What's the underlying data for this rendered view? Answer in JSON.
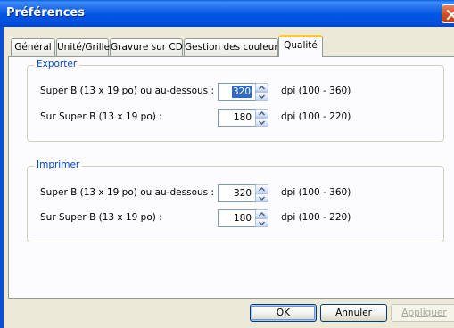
{
  "window": {
    "title": "Préférences"
  },
  "tabs": [
    {
      "label": "Général",
      "active": false
    },
    {
      "label": "Unité/Grille",
      "active": false
    },
    {
      "label": "Gravure sur CD",
      "active": false
    },
    {
      "label": "Gestion des couleurs",
      "active": false
    },
    {
      "label": "Qualité",
      "active": true
    }
  ],
  "export_group": {
    "title": "Exporter",
    "rows": [
      {
        "label": "Super B (13 x 19 po) ou au-dessous :",
        "value": "320",
        "range": "dpi (100 - 360)",
        "selected": true
      },
      {
        "label": "Sur Super B (13 x 19 po) :",
        "value": "180",
        "range": "dpi (100 - 220)",
        "selected": false
      }
    ]
  },
  "print_group": {
    "title": "Imprimer",
    "rows": [
      {
        "label": "Super B (13 x 19 po) ou au-dessous :",
        "value": "320",
        "range": "dpi (100 - 360)",
        "selected": false
      },
      {
        "label": "Sur Super B (13 x 19 po) :",
        "value": "180",
        "range": "dpi (100 - 220)",
        "selected": false
      }
    ]
  },
  "buttons": {
    "ok": "OK",
    "cancel": "Annuler",
    "apply": "Appliquer"
  },
  "colors": {
    "titlebar": "#0055e5",
    "dialog_bg": "#ece9d8",
    "group_title": "#0046d5",
    "selection": "#316ac5",
    "active_tab_highlight": "#ffc83c"
  },
  "icons": {
    "close": "close-icon",
    "spin_up": "chevron-up-icon",
    "spin_down": "chevron-down-icon"
  }
}
